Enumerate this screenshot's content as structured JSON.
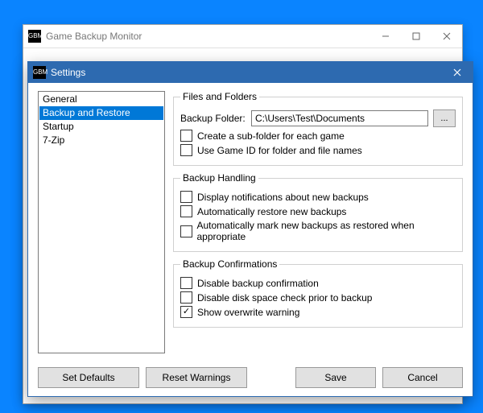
{
  "parentWindow": {
    "title": "Game Backup Monitor",
    "iconText": "GBM"
  },
  "settingsWindow": {
    "title": "Settings",
    "iconText": "GBM"
  },
  "nav": {
    "items": [
      {
        "label": "General"
      },
      {
        "label": "Backup and Restore"
      },
      {
        "label": "Startup"
      },
      {
        "label": "7-Zip"
      }
    ],
    "selectedIndex": 1
  },
  "filesFolders": {
    "legend": "Files and Folders",
    "backupFolderLabel": "Backup Folder:",
    "backupFolderValue": "C:\\Users\\Test\\Documents",
    "browse": "...",
    "createSubfolder": {
      "label": "Create a sub-folder for each game",
      "checked": false
    },
    "useGameId": {
      "label": "Use Game ID for folder and file names",
      "checked": false
    }
  },
  "backupHandling": {
    "legend": "Backup Handling",
    "displayNotifications": {
      "label": "Display notifications about new backups",
      "checked": false
    },
    "autoRestore": {
      "label": "Automatically restore new backups",
      "checked": false
    },
    "autoMarkRestored": {
      "label": "Automatically mark new backups as restored when appropriate",
      "checked": false
    }
  },
  "backupConfirmations": {
    "legend": "Backup Confirmations",
    "disableConfirmation": {
      "label": "Disable backup confirmation",
      "checked": false
    },
    "disableDiskCheck": {
      "label": "Disable disk space check prior to backup",
      "checked": false
    },
    "showOverwrite": {
      "label": "Show overwrite warning",
      "checked": true
    }
  },
  "buttons": {
    "setDefaults": "Set Defaults",
    "resetWarnings": "Reset Warnings",
    "save": "Save",
    "cancel": "Cancel"
  }
}
